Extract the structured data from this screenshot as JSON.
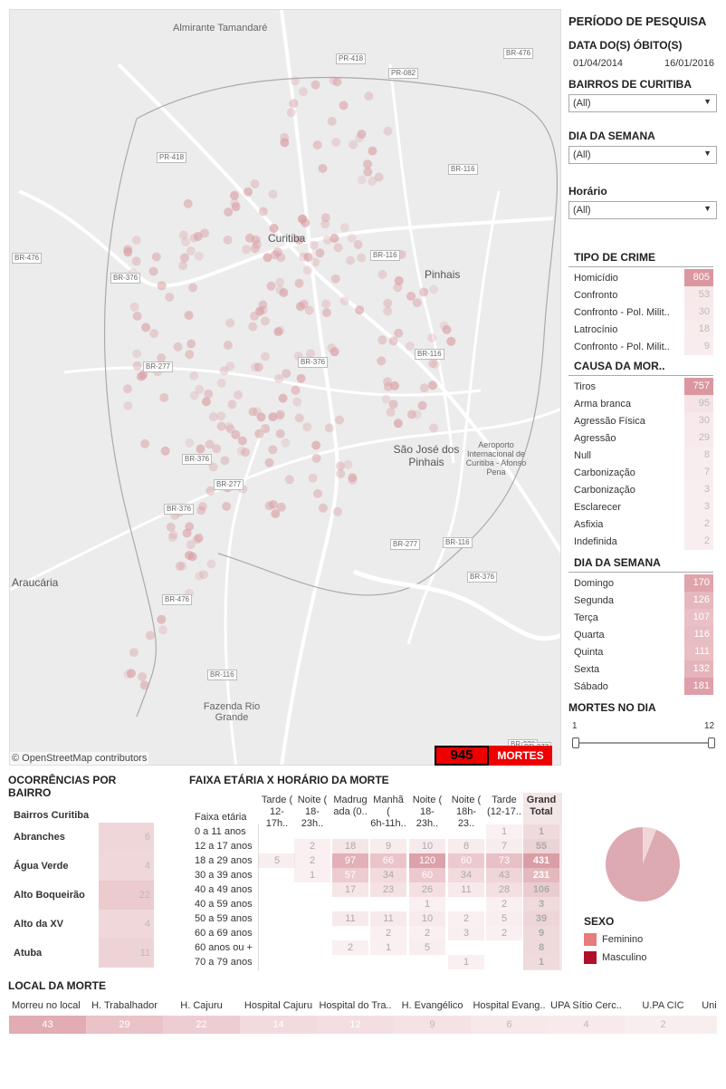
{
  "map": {
    "attribution": "© OpenStreetMap contributors",
    "places": [
      {
        "name": "Almirante Tamandaré",
        "big": false
      },
      {
        "name": "Curitiba",
        "big": true
      },
      {
        "name": "Pinhais",
        "big": true
      },
      {
        "name": "São José dos Pinhais",
        "big": true
      },
      {
        "name": "Aeroporto Internacional de Curitiba - Afonso Pena",
        "big": false
      },
      {
        "name": "Araucária",
        "big": true
      },
      {
        "name": "Fazenda Rio Grande",
        "big": false
      }
    ],
    "routes": [
      "PR-418",
      "PR-082",
      "BR-476",
      "PR-418",
      "BR-116",
      "BR-116",
      "BR-376",
      "BR-277",
      "BR-116",
      "BR-376",
      "BR-277",
      "BR-376",
      "BR-476",
      "BR-277",
      "BR-116",
      "BR-376",
      "BR-376",
      "BR-476",
      "BR-116",
      "BR-376",
      "BR-277"
    ]
  },
  "total": {
    "value": "945",
    "label": "MORTES"
  },
  "filters": {
    "periodo_title": "PERÍODO DE PESQUISA",
    "data_title": "DATA DO(S) ÓBITO(S)",
    "date_from": "01/04/2014",
    "date_to": "16/01/2016",
    "bairros_title": "BAIRROS DE CURITIBA",
    "bairros_value": "(All)",
    "dia_title": "DIA DA SEMANA",
    "dia_value": "(All)",
    "horario_title": "Horário",
    "horario_value": "(All)",
    "mortes_dia_title": "MORTES NO DIA",
    "slider_min": "1",
    "slider_max": "12"
  },
  "tipo_crime": {
    "title": "TIPO DE CRIME",
    "rows": [
      {
        "label": "Homicídio",
        "value": "805"
      },
      {
        "label": "Confronto",
        "value": "53"
      },
      {
        "label": "Confronto - Pol. Milit..",
        "value": "30"
      },
      {
        "label": "Latrocínio",
        "value": "18"
      },
      {
        "label": "Confronto - Pol. Milit..",
        "value": "9"
      }
    ]
  },
  "causa": {
    "title": "CAUSA DA MOR..",
    "rows": [
      {
        "label": "Tiros",
        "value": "757"
      },
      {
        "label": "Arma branca",
        "value": "95"
      },
      {
        "label": "Agressão Física",
        "value": "30"
      },
      {
        "label": "Agressão",
        "value": "29"
      },
      {
        "label": "Null",
        "value": "8"
      },
      {
        "label": "Carbonização",
        "value": "7"
      },
      {
        "label": "Carbonização",
        "value": "3"
      },
      {
        "label": "Esclarecer",
        "value": "3"
      },
      {
        "label": "Asfixia",
        "value": "2"
      },
      {
        "label": "Indefinida",
        "value": "2"
      }
    ]
  },
  "dia_semana": {
    "title": "DIA DA SEMANA",
    "rows": [
      {
        "label": "Domingo",
        "value": "170"
      },
      {
        "label": "Segunda",
        "value": "126"
      },
      {
        "label": "Terça",
        "value": "107"
      },
      {
        "label": "Quarta",
        "value": "116"
      },
      {
        "label": "Quinta",
        "value": "111"
      },
      {
        "label": "Sexta",
        "value": "132"
      },
      {
        "label": "Sábado",
        "value": "181"
      }
    ]
  },
  "ocorrencias": {
    "title1": "OCORRÊNCIAS POR",
    "title2": "BAIRRO",
    "header": "Bairros Curitiba",
    "rows": [
      {
        "label": "Abranches",
        "value": "6"
      },
      {
        "label": "Água Verde",
        "value": "4"
      },
      {
        "label": "Alto Boqueirão",
        "value": "22"
      },
      {
        "label": "Alto da XV",
        "value": "4"
      },
      {
        "label": "Atuba",
        "value": "11"
      }
    ]
  },
  "matrix": {
    "title": "FAIXA ETÁRIA X HORÁRIO DA MORTE",
    "row_header": "Faixa etária",
    "columns": [
      [
        "Tarde (",
        "12-17h.."
      ],
      [
        "Noite (",
        "18-23h.."
      ],
      [
        "Madrug",
        "ada (0.."
      ],
      [
        "Manhã (",
        "6h-11h.."
      ],
      [
        "Noite (",
        "18-23h.."
      ],
      [
        "Noite (",
        "18h-23.."
      ],
      [
        "Tarde",
        "(12-17.."
      ],
      [
        "Grand",
        "Total"
      ]
    ],
    "rows": [
      {
        "label": "0 a 11 anos",
        "cells": [
          "",
          "",
          "",
          "",
          "",
          "",
          "1",
          "1"
        ]
      },
      {
        "label": "12 a 17 anos",
        "cells": [
          "",
          "2",
          "18",
          "9",
          "10",
          "8",
          "7",
          "55"
        ]
      },
      {
        "label": "18 a 29 anos",
        "cells": [
          "5",
          "2",
          "97",
          "66",
          "120",
          "60",
          "73",
          "431"
        ]
      },
      {
        "label": "30 a 39 anos",
        "cells": [
          "",
          "1",
          "57",
          "34",
          "60",
          "34",
          "43",
          "231"
        ]
      },
      {
        "label": "40 a 49 anos",
        "cells": [
          "",
          "",
          "17",
          "23",
          "26",
          "11",
          "28",
          "106"
        ]
      },
      {
        "label": "40 a 59 anos",
        "cells": [
          "",
          "",
          "",
          "",
          "1",
          "",
          "2",
          "3"
        ]
      },
      {
        "label": "50 a 59 anos",
        "cells": [
          "",
          "",
          "11",
          "11",
          "10",
          "2",
          "5",
          "39"
        ]
      },
      {
        "label": "60 a 69 anos",
        "cells": [
          "",
          "",
          "",
          "2",
          "2",
          "3",
          "2",
          "9"
        ]
      },
      {
        "label": "60 anos ou +",
        "cells": [
          "",
          "",
          "2",
          "1",
          "5",
          "",
          "",
          "8"
        ]
      },
      {
        "label": "70 a 79 anos",
        "cells": [
          "",
          "",
          "",
          "",
          "",
          "1",
          "",
          "1"
        ]
      }
    ]
  },
  "sexo": {
    "title": "SEXO",
    "feminino_label": "Feminino",
    "masculino_label": "Masculino",
    "feminino_color": "#e87b7b",
    "masculino_color": "#b0102a",
    "feminino_fraction": 0.06
  },
  "local": {
    "title": "LOCAL DA MORTE",
    "items": [
      {
        "label": "Morreu no local",
        "value": "43"
      },
      {
        "label": "H. Trabalhador",
        "value": "29"
      },
      {
        "label": "H. Cajuru",
        "value": "22"
      },
      {
        "label": "Hospital Cajuru",
        "value": "14"
      },
      {
        "label": "Hospital do Tra..",
        "value": "12"
      },
      {
        "label": "H. Evangélico",
        "value": "9"
      },
      {
        "label": "Hospital Evang..",
        "value": "6"
      },
      {
        "label": "UPA Sítio Cerc..",
        "value": "4"
      },
      {
        "label": "U.PA CIC",
        "value": "2"
      },
      {
        "label": "Uni",
        "value": ""
      }
    ]
  }
}
